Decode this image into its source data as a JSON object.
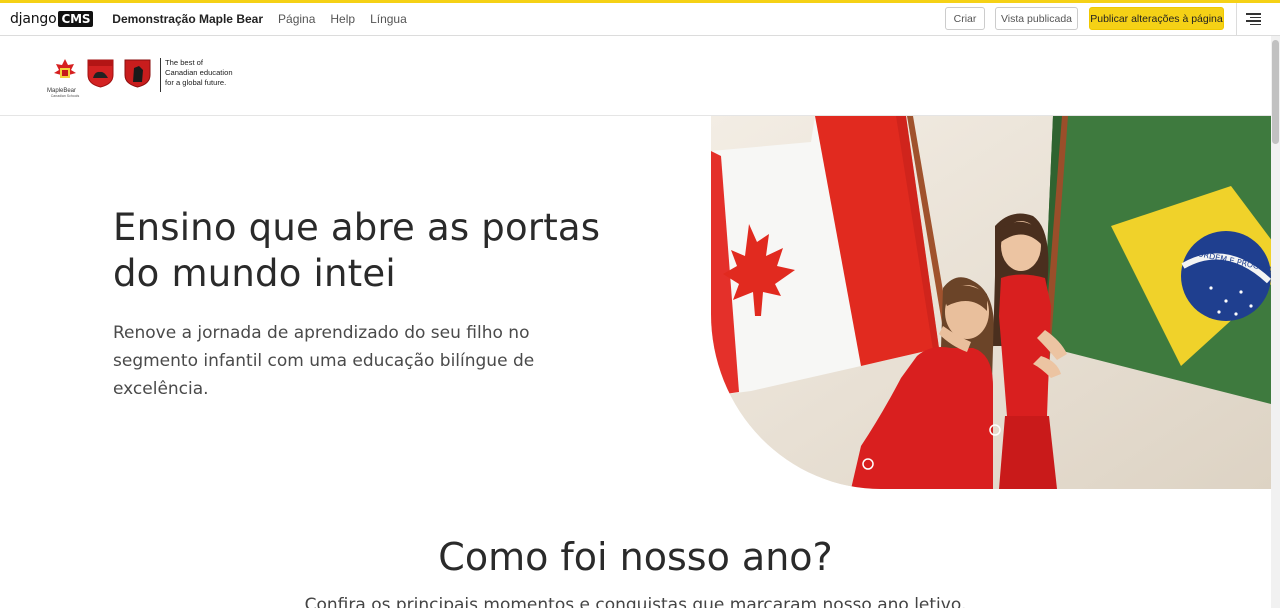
{
  "toolbar": {
    "logo_text": "django",
    "logo_badge": "CMS",
    "site_name": "Demonstração Maple Bear",
    "menu": [
      "Página",
      "Help",
      "Língua"
    ],
    "btn_criar": "Criar",
    "btn_vista": "Vista publicada",
    "btn_publicar": "Publicar alterações à página",
    "accent_color": "#f5d116",
    "menu_icon": "hamburger-icon"
  },
  "header": {
    "tagline": [
      "The best of",
      "Canadian education",
      "for a global future."
    ],
    "logo_label": "MapleBear",
    "logo_caption": "Canadian Schools"
  },
  "hero": {
    "title_line1": "Ensino que abre as portas",
    "title_line2": "do mundo intei",
    "subtitle_line1": "Renove a jornada de aprendizado do seu filho no",
    "subtitle_line2": "segmento infantil com uma educação bilíngue de",
    "subtitle_line3": "excelência.",
    "flag_motto": "ORDEM E PROGRESSO"
  },
  "section": {
    "title": "Como foi nosso ano?",
    "subtitle": "Confira os principais momentos e conquistas que marcaram nosso ano letivo."
  }
}
